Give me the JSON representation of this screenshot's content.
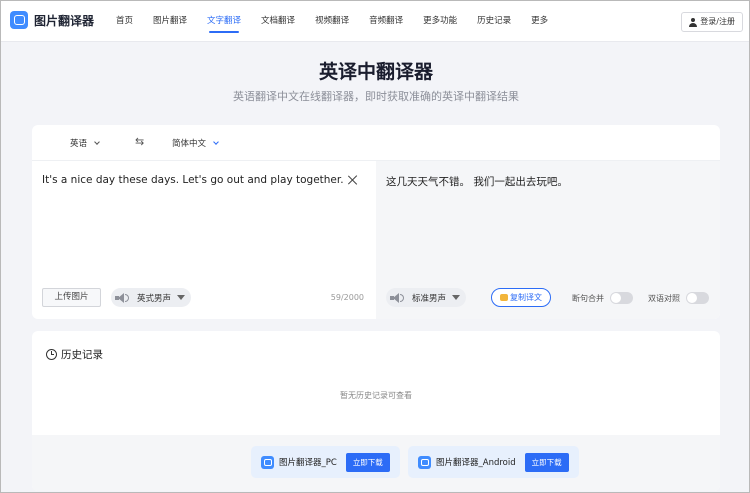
{
  "app": {
    "name": "图片翻译器"
  },
  "nav": {
    "items": [
      {
        "label": "首页",
        "active": false
      },
      {
        "label": "图片翻译",
        "active": false
      },
      {
        "label": "文字翻译",
        "active": true
      },
      {
        "label": "文档翻译",
        "active": false
      },
      {
        "label": "视频翻译",
        "active": false
      },
      {
        "label": "音频翻译",
        "active": false
      },
      {
        "label": "更多功能",
        "active": false
      },
      {
        "label": "历史记录",
        "active": false
      },
      {
        "label": "更多",
        "active": false
      }
    ],
    "login_label": "登录/注册"
  },
  "hero": {
    "title": "英译中翻译器",
    "subtitle": "英语翻译中文在线翻译器，即时获取准确的英译中翻译结果"
  },
  "translator": {
    "source_lang": "英语",
    "swap_icon": "⇆",
    "target_lang": "简体中文",
    "source_text": "It's a nice day these days. Let's go out and play together.",
    "target_text": "这几天天气不错。 我们一起出去玩吧。",
    "upload_label": "上传图片",
    "source_voice": "英式男声",
    "char_count": "59/2000",
    "target_voice": "标准男声",
    "copy_label": "复制译文",
    "toggle_sentence_label": "断句合并",
    "toggle_sentence_on": false,
    "toggle_bilingual_label": "双语对照",
    "toggle_bilingual_on": false
  },
  "history": {
    "title": "历史记录",
    "empty_text": "暂无历史记录可查看"
  },
  "downloads": [
    {
      "name": "图片翻译器_PC",
      "button": "立即下载"
    },
    {
      "name": "图片翻译器_Android",
      "button": "立即下载"
    }
  ],
  "colors": {
    "accent": "#2c6cf6",
    "brand": "#3f8cff"
  }
}
